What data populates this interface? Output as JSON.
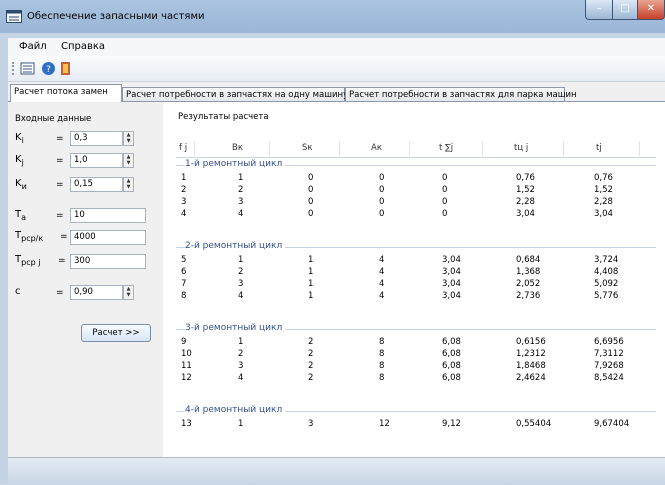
{
  "window": {
    "title": "Обеспечение запасными частями",
    "controls": {
      "minimize": "–",
      "maximize": "□",
      "close": "✕"
    }
  },
  "menu": {
    "items": [
      "Файл",
      "Справка"
    ]
  },
  "toolbar": {
    "buttons": [
      "list-icon",
      "help-icon",
      "exit-icon"
    ]
  },
  "tabs": [
    {
      "label": "Расчет потока замен",
      "active": true
    },
    {
      "label": "Расчет потребности в запчастях на одну машину",
      "active": false
    },
    {
      "label": "Расчет потребности в запчастях для парка машин",
      "active": false
    }
  ],
  "inputs": {
    "section_label": "Входные данные",
    "eq_sign": "=",
    "k_i": {
      "label": "K",
      "sub": "i",
      "value": "0,3"
    },
    "k_j": {
      "label": "K",
      "sub": "j",
      "value": "1,0"
    },
    "k_u": {
      "label": "K",
      "sub": "и",
      "value": "0,15"
    },
    "t_a": {
      "label": "T",
      "sub": "a",
      "value": "10"
    },
    "t_rcpk": {
      "label": "T",
      "sub": "pcp/к",
      "value": "4000"
    },
    "t_rcpj": {
      "label": "T",
      "sub": "pcp j",
      "value": "300"
    },
    "c": {
      "label": "c",
      "value": "0,90"
    }
  },
  "calc_button": "Расчет >>",
  "results": {
    "label": "Результаты расчета",
    "headers": [
      "f j",
      "Bк",
      "Sк",
      "Aк",
      "t ∑j",
      "tц j",
      "tj"
    ],
    "cycles": [
      {
        "label": "1-й ремонтный цикл",
        "rows": [
          [
            "1",
            "1",
            "0",
            "0",
            "0",
            "0,76",
            "0,76"
          ],
          [
            "2",
            "2",
            "0",
            "0",
            "0",
            "1,52",
            "1,52"
          ],
          [
            "3",
            "3",
            "0",
            "0",
            "0",
            "2,28",
            "2,28"
          ],
          [
            "4",
            "4",
            "0",
            "0",
            "0",
            "3,04",
            "3,04"
          ]
        ]
      },
      {
        "label": "2-й ремонтный цикл",
        "rows": [
          [
            "5",
            "1",
            "1",
            "4",
            "3,04",
            "0,684",
            "3,724"
          ],
          [
            "6",
            "2",
            "1",
            "4",
            "3,04",
            "1,368",
            "4,408"
          ],
          [
            "7",
            "3",
            "1",
            "4",
            "3,04",
            "2,052",
            "5,092"
          ],
          [
            "8",
            "4",
            "1",
            "4",
            "3,04",
            "2,736",
            "5,776"
          ]
        ]
      },
      {
        "label": "3-й ремонтный цикл",
        "rows": [
          [
            "9",
            "1",
            "2",
            "8",
            "6,08",
            "0,6156",
            "6,6956"
          ],
          [
            "10",
            "2",
            "2",
            "8",
            "6,08",
            "1,2312",
            "7,3112"
          ],
          [
            "11",
            "3",
            "2",
            "8",
            "6,08",
            "1,8468",
            "7,9268"
          ],
          [
            "12",
            "4",
            "2",
            "8",
            "6,08",
            "2,4624",
            "8,5424"
          ]
        ]
      },
      {
        "label": "4-й ремонтный цикл",
        "rows": [
          [
            "13",
            "1",
            "3",
            "12",
            "9,12",
            "0,55404",
            "9,67404"
          ]
        ]
      }
    ]
  }
}
